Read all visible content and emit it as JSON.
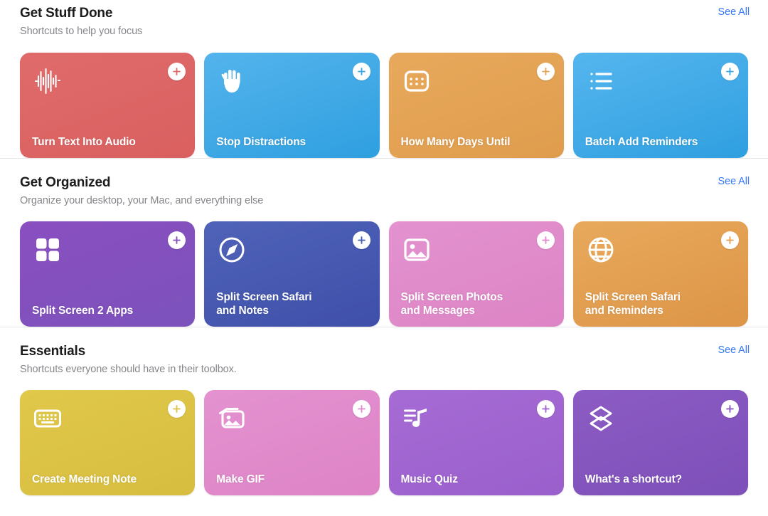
{
  "sections": [
    {
      "title": "Get Stuff Done",
      "subtitle": "Shortcuts to help you focus",
      "see_all_label": "See All",
      "cards": [
        {
          "title": "Turn Text Into Audio",
          "icon": "waveform-icon",
          "color_start": "#e06b6b",
          "color_end": "#d9605f",
          "plus_color": "#de6a68"
        },
        {
          "title": "Stop Distractions",
          "icon": "hand-raised-icon",
          "color_start": "#54b4ec",
          "color_end": "#2f9fe0",
          "plus_color": "#3ba7e4"
        },
        {
          "title": "How Many Days Until",
          "icon": "calendar-icon",
          "color_start": "#e8a95c",
          "color_end": "#df9c4d",
          "plus_color": "#e4a254"
        },
        {
          "title": "Batch Add Reminders",
          "icon": "list-bullet-icon",
          "color_start": "#55b6ee",
          "color_end": "#2f9fe0",
          "plus_color": "#3ba7e4"
        }
      ]
    },
    {
      "title": "Get Organized",
      "subtitle": "Organize your desktop, your Mac, and everything else",
      "see_all_label": "See All",
      "cards": [
        {
          "title": "Split Screen 2 Apps",
          "icon": "grid-squares-icon",
          "color_start": "#8a4fc0",
          "color_end": "#7c52bb",
          "plus_color": "#8350bd"
        },
        {
          "title": "Split Screen Safari\nand Notes",
          "icon": "safari-compass-icon",
          "color_start": "#4f63b8",
          "color_end": "#3f4faa",
          "plus_color": "#4a5cb2"
        },
        {
          "title": "Split Screen Photos\nand Messages",
          "icon": "photo-icon",
          "color_start": "#e392cf",
          "color_end": "#dd84c5",
          "plus_color": "#e08bca"
        },
        {
          "title": "Split Screen Safari\nand Reminders",
          "icon": "globe-icon",
          "color_start": "#e8a95c",
          "color_end": "#dd9547",
          "plus_color": "#e39f52"
        }
      ]
    },
    {
      "title": "Essentials",
      "subtitle": "Shortcuts everyone should have in their toolbox.",
      "see_all_label": "See All",
      "cards": [
        {
          "title": "Create Meeting Note",
          "icon": "keyboard-icon",
          "color_start": "#e0c84b",
          "color_end": "#d7bd3f",
          "plus_color": "#dcc345"
        },
        {
          "title": "Make GIF",
          "icon": "photo-stack-icon",
          "color_start": "#e492d0",
          "color_end": "#dd83c6",
          "plus_color": "#e08bcb"
        },
        {
          "title": "Music Quiz",
          "icon": "music-list-icon",
          "color_start": "#a66bd4",
          "color_end": "#9a5fcc",
          "plus_color": "#a065d0"
        },
        {
          "title": "What's a shortcut?",
          "icon": "layers-icon",
          "color_start": "#8c5cc4",
          "color_end": "#7d4fb8",
          "plus_color": "#8455be"
        }
      ]
    }
  ]
}
